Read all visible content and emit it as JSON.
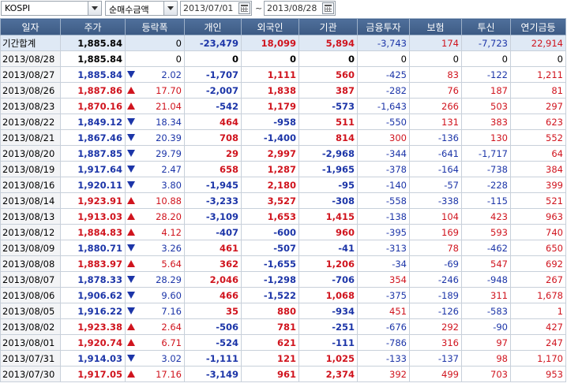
{
  "toolbar": {
    "market": "KOSPI",
    "metric": "순매수금액",
    "date_from": "2013/07/01",
    "date_to": "2013/08/28",
    "separator": "~"
  },
  "headers": [
    "일자",
    "주가",
    "등락폭",
    "개인",
    "외국인",
    "기관",
    "금융투자",
    "보험",
    "투신",
    "연기금등"
  ],
  "total": {
    "label": "기간합계",
    "price": "1,885.84",
    "change": "0",
    "indiv": "-23,479",
    "foreign": "18,099",
    "inst": "5,894",
    "fin": "-3,743",
    "ins": "174",
    "trust": "-7,723",
    "pension": "22,914"
  },
  "rows": [
    {
      "date": "2013/08/28",
      "price": "1,885.84",
      "dir": "flat",
      "change": "0",
      "indiv": "0",
      "foreign": "0",
      "inst": "0",
      "fin": "0",
      "ins": "0",
      "trust": "0",
      "pension": "0"
    },
    {
      "date": "2013/08/27",
      "price": "1,885.84",
      "dir": "dn",
      "change": "2.02",
      "indiv": "-1,707",
      "foreign": "1,111",
      "inst": "560",
      "fin": "-425",
      "ins": "83",
      "trust": "-122",
      "pension": "1,211"
    },
    {
      "date": "2013/08/26",
      "price": "1,887.86",
      "dir": "up",
      "change": "17.70",
      "indiv": "-2,007",
      "foreign": "1,838",
      "inst": "387",
      "fin": "-282",
      "ins": "76",
      "trust": "187",
      "pension": "81"
    },
    {
      "date": "2013/08/23",
      "price": "1,870.16",
      "dir": "up",
      "change": "21.04",
      "indiv": "-542",
      "foreign": "1,179",
      "inst": "-573",
      "fin": "-1,643",
      "ins": "266",
      "trust": "503",
      "pension": "297"
    },
    {
      "date": "2013/08/22",
      "price": "1,849.12",
      "dir": "dn",
      "change": "18.34",
      "indiv": "464",
      "foreign": "-958",
      "inst": "511",
      "fin": "-550",
      "ins": "131",
      "trust": "383",
      "pension": "623"
    },
    {
      "date": "2013/08/21",
      "price": "1,867.46",
      "dir": "dn",
      "change": "20.39",
      "indiv": "708",
      "foreign": "-1,400",
      "inst": "814",
      "fin": "300",
      "ins": "-136",
      "trust": "130",
      "pension": "552"
    },
    {
      "date": "2013/08/20",
      "price": "1,887.85",
      "dir": "dn",
      "change": "29.79",
      "indiv": "29",
      "foreign": "2,997",
      "inst": "-2,968",
      "fin": "-344",
      "ins": "-641",
      "trust": "-1,717",
      "pension": "64"
    },
    {
      "date": "2013/08/19",
      "price": "1,917.64",
      "dir": "dn",
      "change": "2.47",
      "indiv": "658",
      "foreign": "1,287",
      "inst": "-1,965",
      "fin": "-378",
      "ins": "-164",
      "trust": "-738",
      "pension": "384"
    },
    {
      "date": "2013/08/16",
      "price": "1,920.11",
      "dir": "dn",
      "change": "3.80",
      "indiv": "-1,945",
      "foreign": "2,180",
      "inst": "-95",
      "fin": "-140",
      "ins": "-57",
      "trust": "-228",
      "pension": "399"
    },
    {
      "date": "2013/08/14",
      "price": "1,923.91",
      "dir": "up",
      "change": "10.88",
      "indiv": "-3,233",
      "foreign": "3,527",
      "inst": "-308",
      "fin": "-558",
      "ins": "-338",
      "trust": "-115",
      "pension": "521"
    },
    {
      "date": "2013/08/13",
      "price": "1,913.03",
      "dir": "up",
      "change": "28.20",
      "indiv": "-3,109",
      "foreign": "1,653",
      "inst": "1,415",
      "fin": "-138",
      "ins": "104",
      "trust": "423",
      "pension": "963"
    },
    {
      "date": "2013/08/12",
      "price": "1,884.83",
      "dir": "up",
      "change": "4.12",
      "indiv": "-407",
      "foreign": "-600",
      "inst": "960",
      "fin": "-395",
      "ins": "169",
      "trust": "593",
      "pension": "740"
    },
    {
      "date": "2013/08/09",
      "price": "1,880.71",
      "dir": "dn",
      "change": "3.26",
      "indiv": "461",
      "foreign": "-507",
      "inst": "-41",
      "fin": "-313",
      "ins": "78",
      "trust": "-462",
      "pension": "650"
    },
    {
      "date": "2013/08/08",
      "price": "1,883.97",
      "dir": "up",
      "change": "5.64",
      "indiv": "362",
      "foreign": "-1,655",
      "inst": "1,206",
      "fin": "-34",
      "ins": "-69",
      "trust": "547",
      "pension": "692"
    },
    {
      "date": "2013/08/07",
      "price": "1,878.33",
      "dir": "dn",
      "change": "28.29",
      "indiv": "2,046",
      "foreign": "-1,298",
      "inst": "-706",
      "fin": "354",
      "ins": "-246",
      "trust": "-948",
      "pension": "267"
    },
    {
      "date": "2013/08/06",
      "price": "1,906.62",
      "dir": "dn",
      "change": "9.60",
      "indiv": "466",
      "foreign": "-1,522",
      "inst": "1,068",
      "fin": "-375",
      "ins": "-189",
      "trust": "311",
      "pension": "1,678"
    },
    {
      "date": "2013/08/05",
      "price": "1,916.22",
      "dir": "dn",
      "change": "7.16",
      "indiv": "35",
      "foreign": "880",
      "inst": "-934",
      "fin": "451",
      "ins": "-126",
      "trust": "-583",
      "pension": "1"
    },
    {
      "date": "2013/08/02",
      "price": "1,923.38",
      "dir": "up",
      "change": "2.64",
      "indiv": "-506",
      "foreign": "781",
      "inst": "-251",
      "fin": "-676",
      "ins": "292",
      "trust": "-90",
      "pension": "427"
    },
    {
      "date": "2013/08/01",
      "price": "1,920.74",
      "dir": "up",
      "change": "6.71",
      "indiv": "-524",
      "foreign": "621",
      "inst": "-111",
      "fin": "-786",
      "ins": "316",
      "trust": "97",
      "pension": "247"
    },
    {
      "date": "2013/07/31",
      "price": "1,914.03",
      "dir": "dn",
      "change": "3.02",
      "indiv": "-1,111",
      "foreign": "121",
      "inst": "1,025",
      "fin": "-133",
      "ins": "-137",
      "trust": "98",
      "pension": "1,170"
    },
    {
      "date": "2013/07/30",
      "price": "1,917.05",
      "dir": "up",
      "change": "17.16",
      "indiv": "-3,149",
      "foreign": "961",
      "inst": "2,374",
      "fin": "392",
      "ins": "499",
      "trust": "703",
      "pension": "953"
    }
  ]
}
